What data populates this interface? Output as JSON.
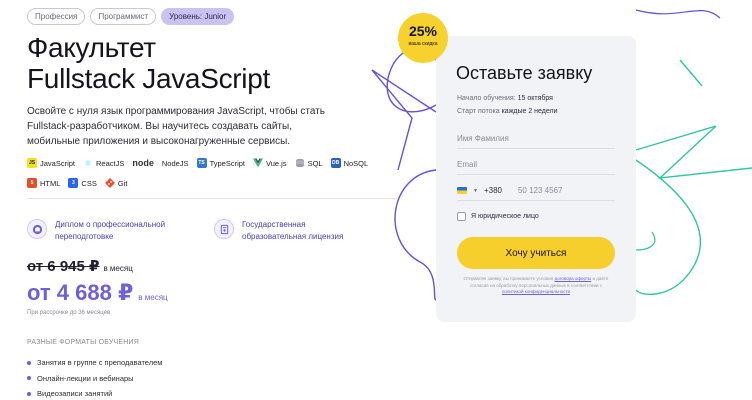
{
  "tags": [
    "Профессия",
    "Программист",
    "Уровень: Junior"
  ],
  "title": {
    "line1": "Факультет",
    "line2": "Fullstack JavaScript"
  },
  "description": "Освойте с нуля язык программирования JavaScript, чтобы стать Fullstack-разработчиком. Вы научитесь создавать сайты, мобильные приложения и высоконагруженные сервисы.",
  "technologies": [
    {
      "label": "JavaScript",
      "icon": "javascript-icon",
      "color": "#f7df1e"
    },
    {
      "label": "ReactJS",
      "icon": "react-icon",
      "color": "#61dafb"
    },
    {
      "label": "node",
      "icon": "node-logo-icon",
      "color": "#333333"
    },
    {
      "label": "NodeJS",
      "icon": "nodejs-icon",
      "color": ""
    },
    {
      "label": "TypeScript",
      "icon": "typescript-icon",
      "color": "#3178c6"
    },
    {
      "label": "Vue.js",
      "icon": "vue-icon",
      "color": "#41b883"
    },
    {
      "label": "SQL",
      "icon": "sql-icon",
      "color": "#9a9aa8"
    },
    {
      "label": "NoSQL",
      "icon": "nosql-icon",
      "color": "#2c5fbf"
    },
    {
      "label": "HTML",
      "icon": "html-icon",
      "color": "#e34f26"
    },
    {
      "label": "CSS",
      "icon": "css-icon",
      "color": "#2965f1"
    },
    {
      "label": "Git",
      "icon": "git-icon",
      "color": "#f05032"
    }
  ],
  "features": [
    {
      "label": "Диплом о профессиональной переподготовке",
      "icon": "diploma-icon"
    },
    {
      "label": "Государственная образовательная лицензия",
      "icon": "license-icon"
    }
  ],
  "price": {
    "old_value": "от 6 945 ₽",
    "old_unit": "в месяц",
    "new_value": "от 4 688 ₽",
    "new_unit": "в месяц",
    "installment": "При рассрочке до 36 месяцев"
  },
  "formats": {
    "title": "РАЗНЫЕ ФОРМАТЫ ОБУЧЕНИЯ",
    "items": [
      "Занятия в группе с преподавателем",
      "Онлайн-лекции и вебинары",
      "Видеозаписи занятий"
    ]
  },
  "discount": {
    "value": "25%",
    "label": "ваша скидка"
  },
  "form": {
    "title": "Оставьте заявку",
    "start_label": "Начало обучения:",
    "start_value": "15 октября",
    "stream_label": "Старт потока",
    "stream_value": "каждые 2 недели",
    "name_placeholder": "Имя Фамилия",
    "email_placeholder": "Email",
    "phone_code": "+380",
    "phone_placeholder": "50 123 4567",
    "legal_checkbox": "Я юридическое лицо",
    "submit": "Хочу учиться",
    "legal_text_1": "Отправляя заявку, вы принимаете условия",
    "legal_link_1": "договора оферты",
    "legal_text_2": "и даёте согласие на обработку персональных данных в соответствии с",
    "legal_link_2": "политикой конфиденциальности"
  },
  "colors": {
    "accent": "#6f5fd8",
    "cta": "#f7cf2c",
    "decoration_green": "#2fc6a4",
    "decoration_purple": "#6a4fd6"
  }
}
